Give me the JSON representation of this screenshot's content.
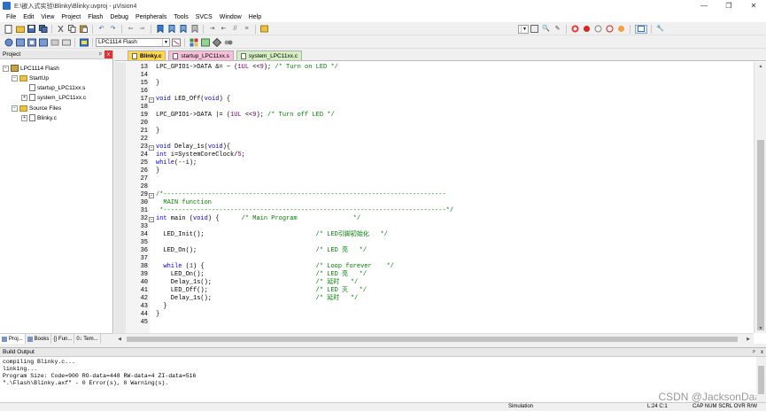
{
  "window": {
    "title": "E:\\嵌入式实验\\Blinky\\Blinky.uvproj - µVision4",
    "minimize": "—",
    "maximize": "❐",
    "close": "✕"
  },
  "menu": [
    "File",
    "Edit",
    "View",
    "Project",
    "Flash",
    "Debug",
    "Peripherals",
    "Tools",
    "SVCS",
    "Window",
    "Help"
  ],
  "toolbar": {
    "target_select": "LPC1114 Flash"
  },
  "project_panel": {
    "title": "Project",
    "pin": "ᵖ",
    "close": "x",
    "tree": [
      {
        "label": "LPC1114 Flash",
        "level": 0,
        "kind": "target",
        "expander": "−"
      },
      {
        "label": "StartUp",
        "level": 1,
        "kind": "folder",
        "expander": "−"
      },
      {
        "label": "startup_LPC11xx.s",
        "level": 2,
        "kind": "file",
        "expander": ""
      },
      {
        "label": "system_LPC11xx.c",
        "level": 2,
        "kind": "file",
        "expander": "+"
      },
      {
        "label": "Source Files",
        "level": 1,
        "kind": "folder",
        "expander": "−"
      },
      {
        "label": "Blinky.c",
        "level": 2,
        "kind": "file",
        "expander": "+"
      }
    ],
    "tabs": [
      "Proj...",
      "Books",
      "{} Fun...",
      "0↓ Tem..."
    ]
  },
  "editor": {
    "tabs": [
      {
        "label": "Blinky.c",
        "active": true
      },
      {
        "label": "startup_LPC11xx.s",
        "active": false
      },
      {
        "label": "system_LPC11xx.c",
        "active": false
      }
    ],
    "lines": [
      {
        "n": "13",
        "fold": "",
        "code": "LPC_GPIO1->DATA &= ~ (1UL <<9); ",
        "comment": "/* Turn on LED */"
      },
      {
        "n": "14",
        "fold": "",
        "code": "",
        "comment": ""
      },
      {
        "n": "15",
        "fold": "",
        "code": "}",
        "comment": ""
      },
      {
        "n": "16",
        "fold": "",
        "code": "",
        "comment": ""
      },
      {
        "n": "17",
        "fold": "−",
        "code": "void LED_Off(void) {",
        "comment": ""
      },
      {
        "n": "18",
        "fold": "",
        "code": "",
        "comment": ""
      },
      {
        "n": "19",
        "fold": "",
        "code": "LPC_GPIO1->DATA |= (1UL <<9); ",
        "comment": "/* Turn off LED */"
      },
      {
        "n": "20",
        "fold": "",
        "code": "",
        "comment": ""
      },
      {
        "n": "21",
        "fold": "",
        "code": "}",
        "comment": ""
      },
      {
        "n": "22",
        "fold": "",
        "code": "",
        "comment": ""
      },
      {
        "n": "23",
        "fold": "−",
        "code": "void Delay_1s(void){",
        "comment": ""
      },
      {
        "n": "24",
        "fold": "",
        "code": "int i=SystemCoreClock/5;",
        "comment": ""
      },
      {
        "n": "25",
        "fold": "",
        "code": "while(--i);",
        "comment": ""
      },
      {
        "n": "26",
        "fold": "",
        "code": "}",
        "comment": ""
      },
      {
        "n": "27",
        "fold": "",
        "code": "",
        "comment": ""
      },
      {
        "n": "28",
        "fold": "",
        "code": "",
        "comment": ""
      },
      {
        "n": "29",
        "fold": "−",
        "code": "",
        "comment": "/*----------------------------------------------------------------------------"
      },
      {
        "n": "30",
        "fold": "",
        "code": "",
        "comment": "  MAIN function"
      },
      {
        "n": "31",
        "fold": "",
        "code": "",
        "comment": " *----------------------------------------------------------------------------*/"
      },
      {
        "n": "32",
        "fold": "−",
        "code": "int main (void) {      ",
        "comment": "/* Main Program               */"
      },
      {
        "n": "33",
        "fold": "",
        "code": "",
        "comment": ""
      },
      {
        "n": "34",
        "fold": "",
        "code": "  LED_Init();                              ",
        "comment": "/* LED引脚初始化   */"
      },
      {
        "n": "35",
        "fold": "",
        "code": "",
        "comment": ""
      },
      {
        "n": "36",
        "fold": "",
        "code": "  LED_On();                                ",
        "comment": "/* LED 亮   */"
      },
      {
        "n": "37",
        "fold": "",
        "code": "",
        "comment": ""
      },
      {
        "n": "38",
        "fold": "",
        "code": "  while (1) {                              ",
        "comment": "/* Loop forever    */"
      },
      {
        "n": "39",
        "fold": "",
        "code": "    LED_On();                              ",
        "comment": "/* LED 亮   */"
      },
      {
        "n": "40",
        "fold": "",
        "code": "    Delay_1s();                            ",
        "comment": "/* 延时   */"
      },
      {
        "n": "41",
        "fold": "",
        "code": "    LED_Off();                             ",
        "comment": "/* LED 灭   */"
      },
      {
        "n": "42",
        "fold": "",
        "code": "    Delay_1s();                            ",
        "comment": "/* 延时   */"
      },
      {
        "n": "43",
        "fold": "",
        "code": "  }",
        "comment": ""
      },
      {
        "n": "44",
        "fold": "",
        "code": "}",
        "comment": ""
      },
      {
        "n": "45",
        "fold": "",
        "code": "",
        "comment": ""
      }
    ]
  },
  "build_output": {
    "title": "Build Output",
    "lines": [
      "compiling Blinky.c...",
      "linking...",
      "Program Size: Code=900 RO-data=448 RW-data=4 ZI-data=516",
      "\".\\Flash\\Blinky.axf\" - 0 Error(s), 0 Warning(s)."
    ],
    "watermark": "CSDN @JacksonDaa"
  },
  "status": {
    "mode": "Simulation",
    "position": "L:24 C:1",
    "indicators": "CAP  NUM  SCRL  OVR  R/W"
  }
}
